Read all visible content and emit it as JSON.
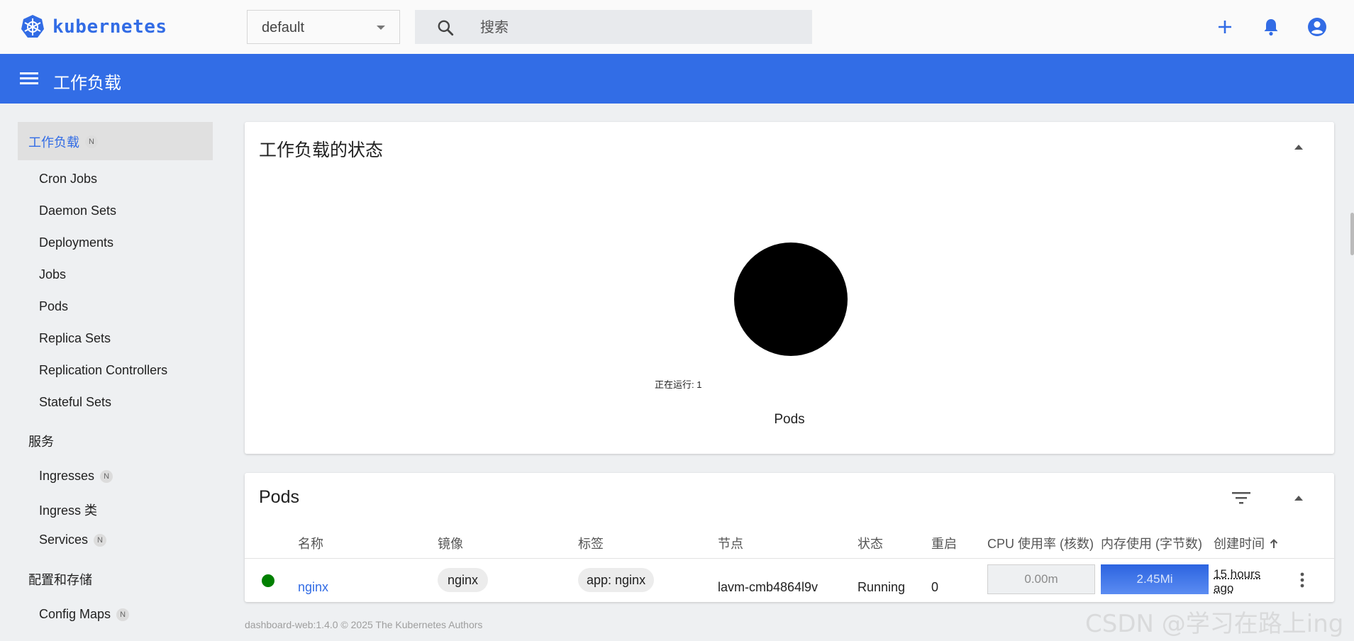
{
  "app": {
    "name": "kubernetes"
  },
  "topbar": {
    "namespace": "default",
    "search_placeholder": "搜索"
  },
  "header": {
    "title": "工作负载"
  },
  "sidebar": {
    "active": {
      "label": "工作负载",
      "badge": "N"
    },
    "workload_items": [
      {
        "label": "Cron Jobs"
      },
      {
        "label": "Daemon Sets"
      },
      {
        "label": "Deployments"
      },
      {
        "label": "Jobs"
      },
      {
        "label": "Pods"
      },
      {
        "label": "Replica Sets"
      },
      {
        "label": "Replication Controllers"
      },
      {
        "label": "Stateful Sets"
      }
    ],
    "services_section": "服务",
    "service_items": [
      {
        "label": "Ingresses",
        "badge": "N"
      },
      {
        "label": "Ingress 类"
      },
      {
        "label": "Services",
        "badge": "N"
      }
    ],
    "config_section": "配置和存储",
    "config_items": [
      {
        "label": "Config Maps",
        "badge": "N"
      }
    ]
  },
  "status_card": {
    "title": "工作负载的状态",
    "pie_label": "正在运行: 1",
    "pie_caption": "Pods",
    "chart_data": {
      "type": "pie",
      "title": "Pods",
      "slices": [
        {
          "label": "正在运行",
          "value": 1
        }
      ]
    }
  },
  "pods_card": {
    "title": "Pods",
    "columns": {
      "name": "名称",
      "image": "镜像",
      "labels": "标签",
      "node": "节点",
      "status": "状态",
      "restarts": "重启",
      "cpu": "CPU 使用率 (核数)",
      "memory": "内存使用 (字节数)",
      "created": "创建时间"
    },
    "rows": [
      {
        "name": "nginx",
        "image": "nginx",
        "labels": "app: nginx",
        "node": "lavm-cmb4864l9v",
        "status": "Running",
        "restarts": "0",
        "cpu": "0.00m",
        "memory": "2.45Mi",
        "created_line1": "15 hours",
        "created_line2": "ago"
      }
    ]
  },
  "footer": {
    "text": "dashboard-web:1.4.0 © 2025 The Kubernetes Authors"
  },
  "watermark": "CSDN @学习在路上ing",
  "colors": {
    "brand": "#326ce5",
    "header": "#326de6",
    "running": "#008000"
  }
}
